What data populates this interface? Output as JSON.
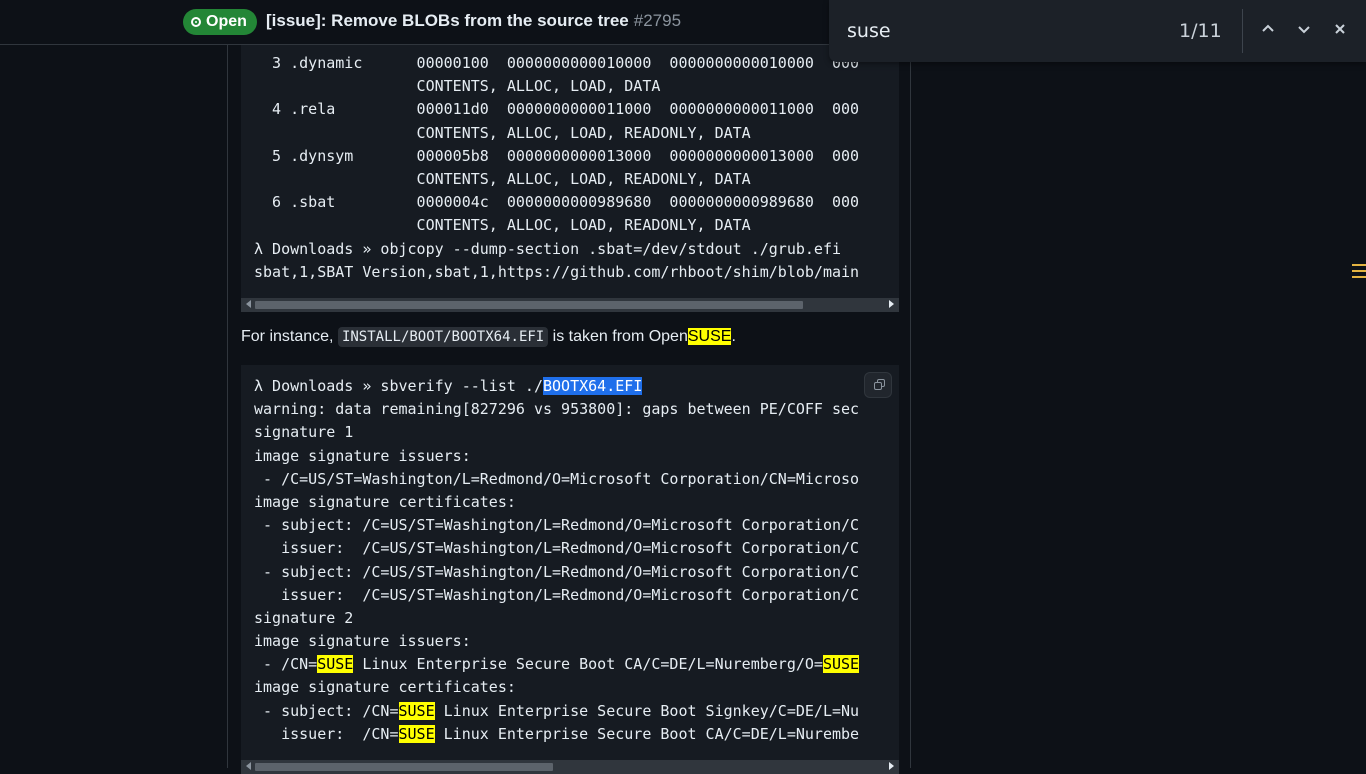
{
  "issue": {
    "status": "Open",
    "title": "[issue]: Remove BLOBs from the source tree",
    "number": "#2795"
  },
  "find": {
    "query": "suse",
    "count": "1/11"
  },
  "code1": {
    "lines": [
      "  3 .dynamic      00000100  0000000000010000  0000000000010000  000",
      "                  CONTENTS, ALLOC, LOAD, DATA",
      "  4 .rela         000011d0  0000000000011000  0000000000011000  000",
      "                  CONTENTS, ALLOC, LOAD, READONLY, DATA",
      "  5 .dynsym       000005b8  0000000000013000  0000000000013000  000",
      "                  CONTENTS, ALLOC, LOAD, READONLY, DATA",
      "  6 .sbat         0000004c  0000000000989680  0000000000989680  000",
      "                  CONTENTS, ALLOC, LOAD, READONLY, DATA",
      "λ Downloads » objcopy --dump-section .sbat=/dev/stdout ./grub.efi",
      "sbat,1,SBAT Version,sbat,1,https://github.com/rhboot/shim/blob/main"
    ]
  },
  "paragraph": {
    "before": "For instance, ",
    "code": "INSTALL/BOOT/BOOTX64.EFI",
    "middle": " is taken from Open",
    "highlight": "SUSE",
    "after": "."
  },
  "code2": {
    "first_prefix": "λ Downloads » sbverify --list ./",
    "first_selected": "BOOTX64.EFI",
    "lines": [
      "warning: data remaining[827296 vs 953800]: gaps between PE/COFF sec",
      "signature 1",
      "image signature issuers:",
      " - /C=US/ST=Washington/L=Redmond/O=Microsoft Corporation/CN=Microso",
      "image signature certificates:",
      " - subject: /C=US/ST=Washington/L=Redmond/O=Microsoft Corporation/C",
      "   issuer:  /C=US/ST=Washington/L=Redmond/O=Microsoft Corporation/C",
      " - subject: /C=US/ST=Washington/L=Redmond/O=Microsoft Corporation/C",
      "   issuer:  /C=US/ST=Washington/L=Redmond/O=Microsoft Corporation/C",
      "signature 2",
      "image signature issuers:"
    ],
    "suse_line1": [
      " - /CN=",
      "SUSE",
      " Linux Enterprise Secure Boot CA/C=DE/L=Nuremberg/O=",
      "SUSE"
    ],
    "line_certs": "image signature certificates:",
    "suse_line2": [
      " - subject: /CN=",
      "SUSE",
      " Linux Enterprise Secure Boot Signkey/C=DE/L=Nu"
    ],
    "suse_line3": [
      "   issuer:  /CN=",
      "SUSE",
      " Linux Enterprise Secure Boot CA/C=DE/L=Nurembe"
    ]
  }
}
